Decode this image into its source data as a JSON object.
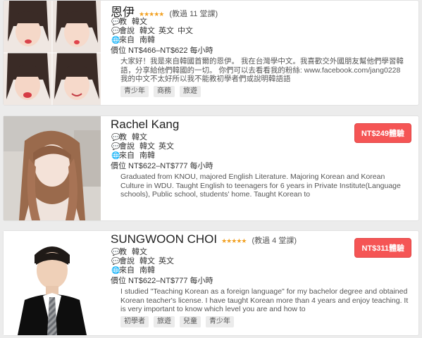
{
  "tutors": [
    {
      "name": "恩伊",
      "stars": "★★★★★",
      "lessons": "(教過 11 堂課)",
      "teach_label": "教",
      "teach": [
        "韓文"
      ],
      "speak_label": "會說",
      "speak": [
        "韓文",
        "英文",
        "中文"
      ],
      "from_label": "來自",
      "from": "南韓",
      "price": "價位 NT$466–NT$622 每小時",
      "bio": "大家好！我是來自韓國首爾的恩伊。 我在台灣學中文。我喜歡交外國朋友幫他們學習韓語，分享給他們韓國的一切。 你們可以去看看我的粉絲: www.facebook.com/jang0228 我的中文不太好所以我不能教初學者們或說明韓語語",
      "tags": [
        "青少年",
        "商務",
        "旅遊"
      ],
      "trial": ""
    },
    {
      "name": "Rachel Kang",
      "stars": "",
      "lessons": "",
      "teach_label": "教",
      "teach": [
        "韓文"
      ],
      "speak_label": "會說",
      "speak": [
        "韓文",
        "英文"
      ],
      "from_label": "來自",
      "from": "南韓",
      "price": "價位 NT$622–NT$777 每小時",
      "bio": "Graduated from KNOU, majored English Literature. Majoring Korean and Korean Culture in WDU. Taught English to teenagers for 6 years in Private Institute(Language schools), Public school, students' home. Taught Korean to",
      "tags": [],
      "trial": "NT$249體驗"
    },
    {
      "name": "SUNGWOON CHOI",
      "stars": "★★★★★",
      "lessons": "(教過 4 堂課)",
      "teach_label": "教",
      "teach": [
        "韓文"
      ],
      "speak_label": "會說",
      "speak": [
        "韓文",
        "英文"
      ],
      "from_label": "來自",
      "from": "南韓",
      "price": "價位 NT$622–NT$777 每小時",
      "bio": "I studied \"Teaching Korean as a foreign language\" for my bachelor degree and obtained Korean teacher's license. I have taught Korean more than 4 years and enjoy teaching. It is very important to know which level you are and how to",
      "tags": [
        "初學者",
        "旅遊",
        "兒童",
        "青少年"
      ],
      "trial": "NT$311體驗"
    }
  ],
  "icons": {
    "teach": "chat-bubble-icon",
    "speak": "chat-bubble-icon",
    "from": "globe-icon"
  },
  "colors": {
    "trial_button": "#f55555",
    "stars": "#f2a122",
    "tag_bg": "#ebebeb"
  }
}
